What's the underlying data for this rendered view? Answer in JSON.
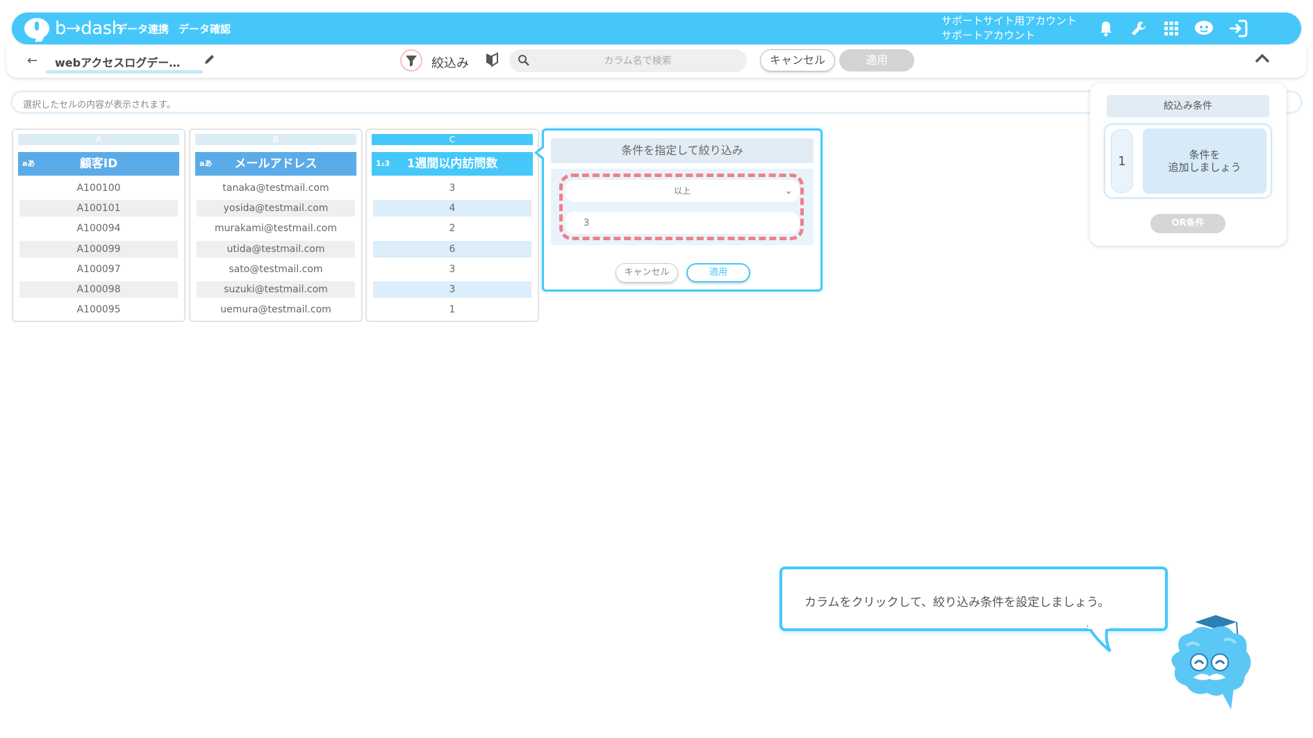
{
  "app": {
    "logo_text": "b→dash",
    "nav": [
      "データ連携",
      "データ確認"
    ],
    "account": {
      "line1": "サポートサイト用アカウント",
      "line2": "サポートアカウント"
    },
    "icons": [
      "bell-icon",
      "wrench-icon",
      "grid-icon",
      "mascot-icon",
      "logout-icon"
    ]
  },
  "toolbar": {
    "back_icon": "arrow-left-icon",
    "dataset_name": "webアクセスログデー…",
    "filter_label": "絞込み",
    "search_placeholder": "カラム名で検索",
    "cancel_label": "キャンセル",
    "apply_label": "適用"
  },
  "cell_bar": {
    "placeholder": "選択したセルの内容が表示されます。"
  },
  "columns": [
    {
      "letter": "A",
      "type": "aあ",
      "name": "顧客ID",
      "active": false,
      "values": [
        "A100100",
        "A100101",
        "A100094",
        "A100099",
        "A100097",
        "A100098",
        "A100095"
      ]
    },
    {
      "letter": "B",
      "type": "aあ",
      "name": "メールアドレス",
      "active": false,
      "values": [
        "tanaka@testmail.com",
        "yosida@testmail.com",
        "murakami@testmail.com",
        "utida@testmail.com",
        "sato@testmail.com",
        "suzuki@testmail.com",
        "uemura@testmail.com"
      ]
    },
    {
      "letter": "C",
      "type": "1₂3",
      "name": "1週間以内訪問数",
      "active": true,
      "values": [
        "3",
        "4",
        "2",
        "6",
        "3",
        "3",
        "1"
      ]
    }
  ],
  "filter_popup": {
    "title": "条件を指定して絞り込み",
    "operator": "以上",
    "value": "3",
    "cancel_label": "キャンセル",
    "apply_label": "適用"
  },
  "conditions_panel": {
    "title": "絞込み条件",
    "group_number": "1",
    "add_line1": "条件を",
    "add_line2": "追加しましょう",
    "or_label": "OR条件"
  },
  "tutorial": {
    "message": "カラムをクリックして、絞り込み条件を設定しましょう。"
  },
  "colors": {
    "accent": "#45c8f9",
    "header_blue": "#5aabe8",
    "highlight_dash": "#f08088"
  }
}
